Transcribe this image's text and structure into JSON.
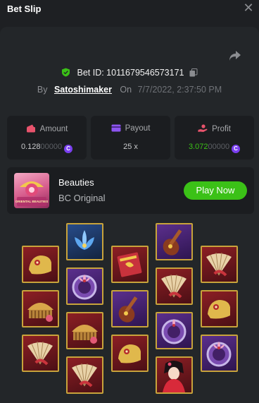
{
  "header": {
    "title": "Bet Slip",
    "close_icon": "close-icon"
  },
  "bet": {
    "id_label": "Bet ID: 1011679546573171",
    "by_label": "By",
    "username": "Satoshimaker",
    "on_label": "On",
    "datetime": "7/7/2022, 2:37:50 PM"
  },
  "stats": {
    "amount": {
      "label": "Amount",
      "value_main": "0.128",
      "value_zeros": "00000",
      "icon": "wallet-icon"
    },
    "payout": {
      "label": "Payout",
      "value": "25 x",
      "icon": "card-icon"
    },
    "profit": {
      "label": "Profit",
      "value_main": "3.072",
      "value_zeros": "00000",
      "icon": "hand-coin-icon"
    }
  },
  "game": {
    "name": "Beauties",
    "provider": "BC Original",
    "play_label": "Play Now",
    "thumb_text": "ORIENTAL BEAUTIES"
  },
  "colors": {
    "accent_green": "#3bc117",
    "coin_purple": "#7a3ff0",
    "frame_gold": "#c8a33b"
  },
  "reels": [
    [
      "shoe-icon",
      "comb-icon",
      "fan-icon"
    ],
    [
      "lotus-icon",
      "mirror-icon",
      "comb-icon",
      "fan-icon"
    ],
    [
      "book-icon",
      "pipa-icon",
      "shoe-icon"
    ],
    [
      "pipa-icon",
      "fan-icon",
      "mirror-icon",
      "beauty-icon"
    ],
    [
      "fan-icon",
      "shoe-icon",
      "mirror-icon"
    ]
  ]
}
